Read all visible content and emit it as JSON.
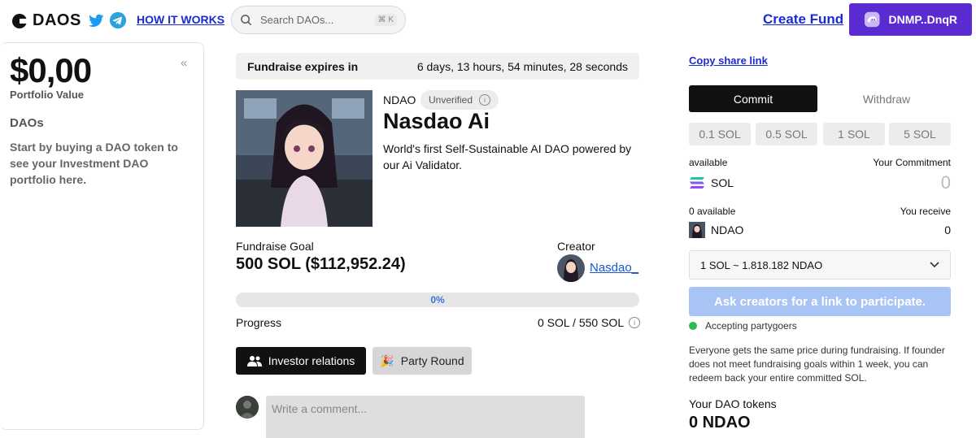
{
  "nav": {
    "logo_text": "DAOS",
    "how_it_works": "HOW IT WORKS",
    "search_placeholder": "Search DAOs...",
    "search_shortcut": "⌘ K",
    "create_fund": "Create Fund",
    "wallet_label": "DNMP..DnqR",
    "brand_color": "#5b2bd2",
    "link_color": "#1a2bd6"
  },
  "sidebar": {
    "portfolio_value": "$0,00",
    "portfolio_label": "Portfolio Value",
    "daos_heading": "DAOs",
    "daos_text": "Start by buying a DAO token to see your Investment DAO portfolio here."
  },
  "fund": {
    "expires_label": "Fundraise expires in",
    "expires_value": "6 days, 13 hours, 54 minutes, 28 seconds",
    "ticker": "NDAO",
    "verification": "Unverified",
    "name": "Nasdao Ai",
    "description": "World's first Self-Sustainable AI DAO powered by our Ai Validator.",
    "goal_label": "Fundraise Goal",
    "goal_value": "500 SOL ($112,952.24)",
    "creator_label": "Creator",
    "creator_name": "Nasdao_",
    "progress_pct_text": "0%",
    "progress_fraction": 0,
    "progress_label": "Progress",
    "progress_value": "0 SOL / 550 SOL",
    "investor_button": "Investor relations",
    "party_button": "Party Round",
    "comment_placeholder": "Write a comment..."
  },
  "panel": {
    "copy_share": "Copy share link",
    "tabs": [
      "Commit",
      "Withdraw"
    ],
    "amounts": [
      "0.1 SOL",
      "0.5 SOL",
      "1 SOL",
      "5 SOL"
    ],
    "available_label": "available",
    "your_commitment_label": "Your Commitment",
    "sol_label": "SOL",
    "commitment_value": "0",
    "available2_label": "0 available",
    "you_receive_label": "You receive",
    "ndao_label": "NDAO",
    "receive_value": "0",
    "rate": "1 SOL ~ 1.818.182 NDAO",
    "ask_button": "Ask creators for a link to participate.",
    "accepting": "Accepting partygoers",
    "fine_print": "Everyone gets the same price during fundraising. If founder does not meet fundraising goals within 1 week, you can redeem back your entire committed SOL.",
    "tokens_label": "Your DAO tokens",
    "tokens_value": "0 NDAO"
  }
}
